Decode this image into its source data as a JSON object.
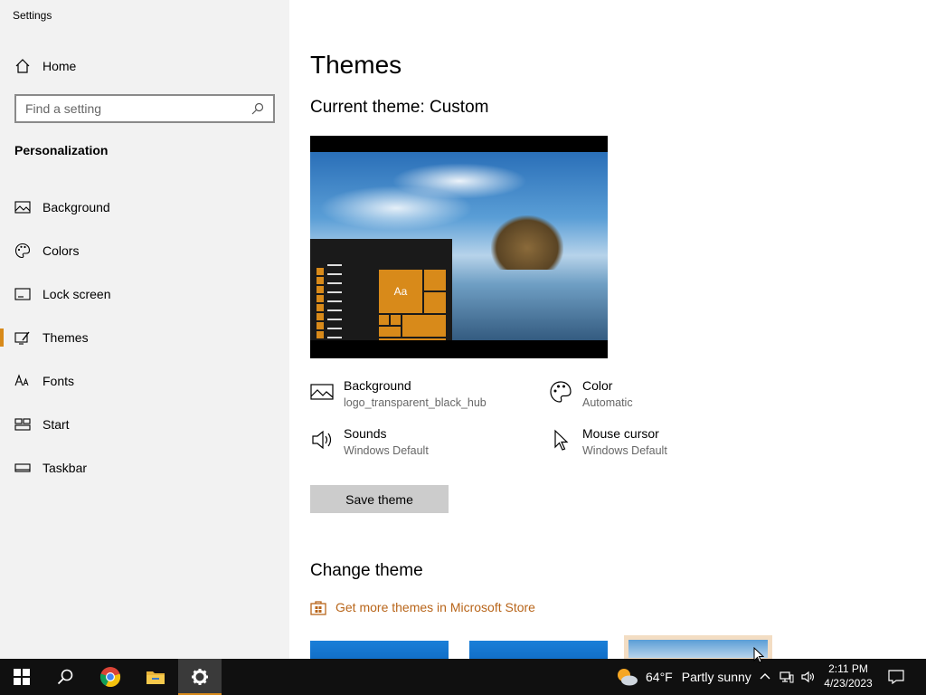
{
  "window": {
    "title": "Settings"
  },
  "sidebar": {
    "home_label": "Home",
    "search_placeholder": "Find a setting",
    "section_title": "Personalization",
    "items": [
      {
        "label": "Background",
        "icon": "image-icon"
      },
      {
        "label": "Colors",
        "icon": "palette-icon"
      },
      {
        "label": "Lock screen",
        "icon": "lock-screen-icon"
      },
      {
        "label": "Themes",
        "icon": "themes-icon",
        "active": true
      },
      {
        "label": "Fonts",
        "icon": "fonts-icon"
      },
      {
        "label": "Start",
        "icon": "start-icon"
      },
      {
        "label": "Taskbar",
        "icon": "taskbar-icon"
      }
    ]
  },
  "main": {
    "title": "Themes",
    "current_theme": "Current theme: Custom",
    "preview_tile_text": "Aa",
    "props": {
      "background": {
        "title": "Background",
        "value": "logo_transparent_black_hub"
      },
      "color": {
        "title": "Color",
        "value": "Automatic"
      },
      "sounds": {
        "title": "Sounds",
        "value": "Windows Default"
      },
      "mouse": {
        "title": "Mouse cursor",
        "value": "Windows Default"
      }
    },
    "save_button": "Save theme",
    "change_theme_title": "Change theme",
    "store_link": "Get more themes in Microsoft Store"
  },
  "taskbar": {
    "weather_temp": "64°F",
    "weather_condition": "Partly sunny",
    "time": "2:11 PM",
    "date": "4/23/2023"
  },
  "colors": {
    "accent": "#d88a1a",
    "sidebar_bg": "#f2f2f2",
    "taskbar_bg": "#101010",
    "link": "#b8651a"
  }
}
